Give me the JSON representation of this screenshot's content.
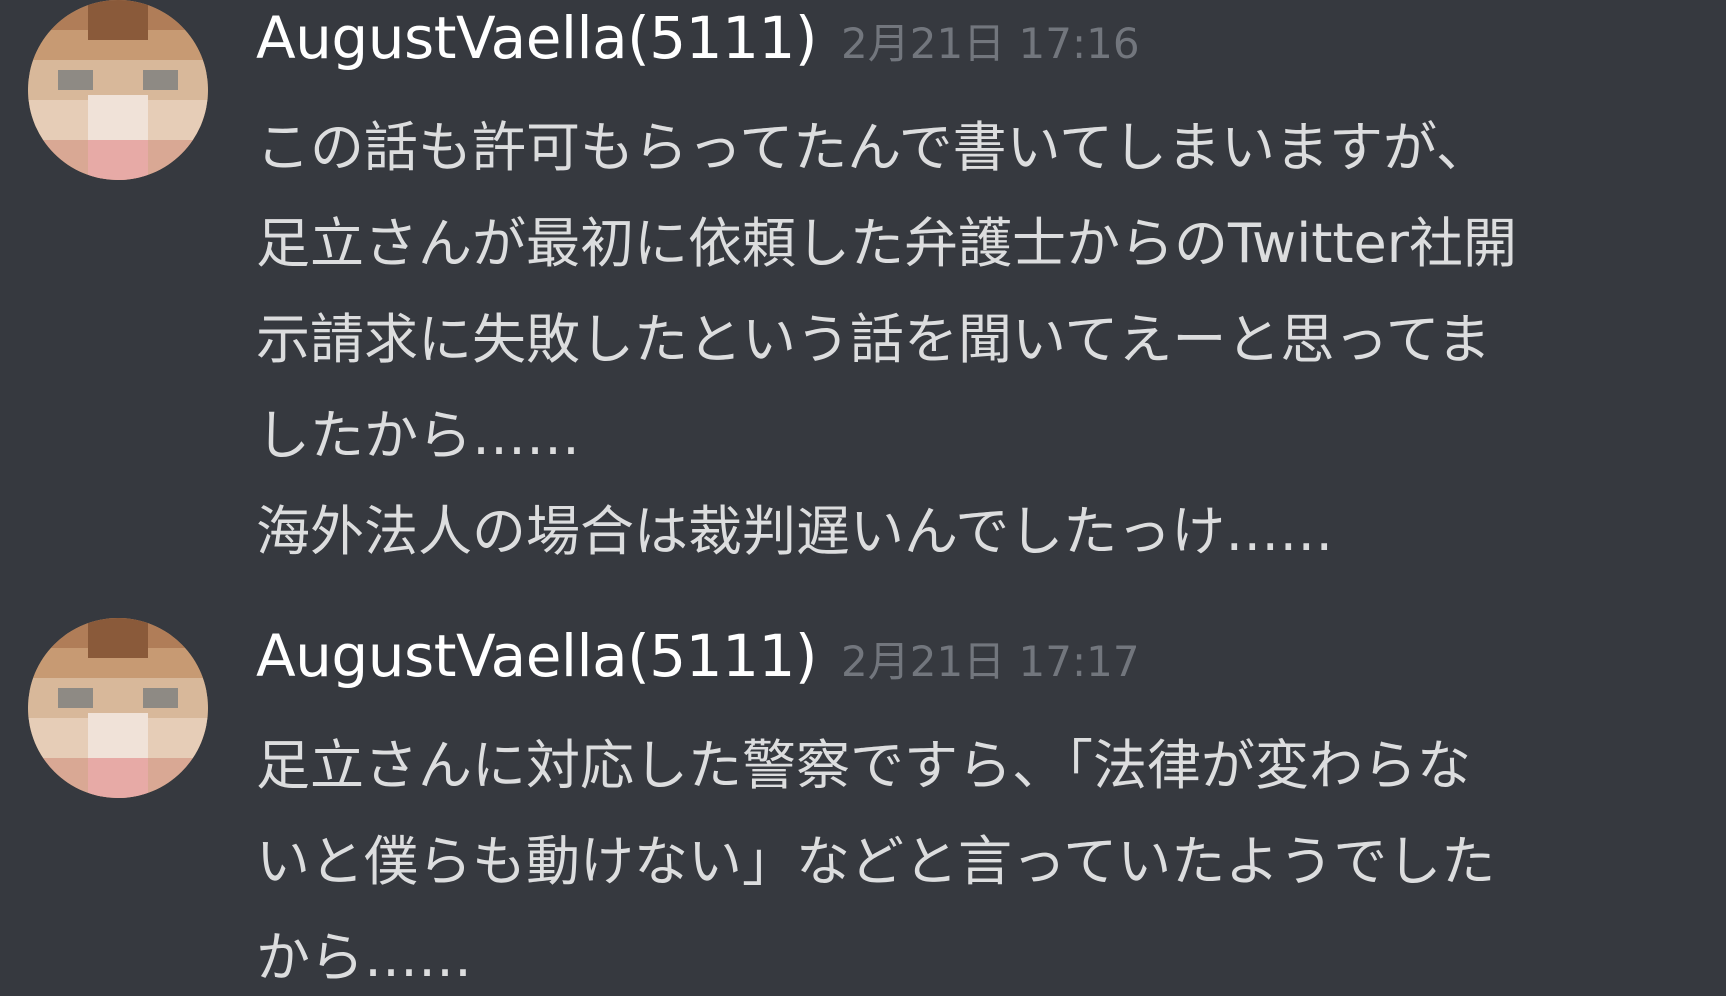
{
  "messages": [
    {
      "username": "AugustVaella(5111)",
      "timestamp": "2月21日 17:16",
      "lines": [
        "この話も許可もらってたんで書いてしまいますが、",
        "足立さんが最初に依頼した弁護士からのTwitter社開",
        "示請求に失敗したという話を聞いてえーと思ってま",
        "したから……",
        "海外法人の場合は裁判遅いんでしたっけ……"
      ]
    },
    {
      "username": "AugustVaella(5111)",
      "timestamp": "2月21日 17:17",
      "lines": [
        "足立さんに対応した警察ですら、「法律が変わらな",
        "いと僕らも動けない」などと言っていたようでした",
        "から……"
      ]
    }
  ],
  "colors": {
    "background": "#36393f",
    "username": "#ffffff",
    "timestamp": "#72767d",
    "message_text": "#dcddde"
  },
  "icons": {
    "avatar": "pixelated-avatar"
  }
}
